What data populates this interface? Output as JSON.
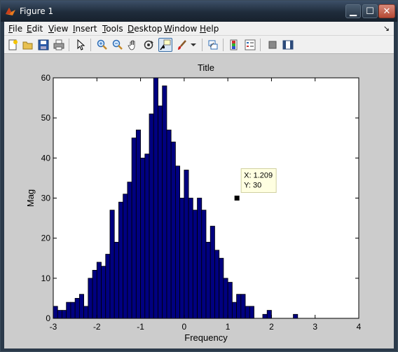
{
  "window": {
    "title": "Figure 1",
    "minimize": "▁",
    "maximize": "☐",
    "close": "✕"
  },
  "menu": [
    {
      "label": "File",
      "key": "F",
      "rest": "ile"
    },
    {
      "label": "Edit",
      "key": "E",
      "rest": "dit"
    },
    {
      "label": "View",
      "key": "V",
      "rest": "iew"
    },
    {
      "label": "Insert",
      "key": "I",
      "rest": "nsert"
    },
    {
      "label": "Tools",
      "key": "T",
      "rest": "ools"
    },
    {
      "label": "Desktop",
      "key": "D",
      "rest": "esktop"
    },
    {
      "label": "Window",
      "key": "W",
      "rest": "indow"
    },
    {
      "label": "Help",
      "key": "H",
      "rest": "elp"
    }
  ],
  "dock_arrow": "↘",
  "toolbar": [
    "new-figure-icon",
    "open-file-icon",
    "save-icon",
    "print-icon",
    "pointer-icon",
    "zoom-in-icon",
    "zoom-out-icon",
    "pan-hand-icon",
    "rotate-3d-icon",
    "data-cursor-icon",
    "brush-icon",
    "brush-dropdown-icon",
    "link-plot-icon",
    "colorbar-icon",
    "legend-icon",
    "hide-plot-tools-icon",
    "show-plot-tools-icon"
  ],
  "chart_data": {
    "type": "bar",
    "title": "Title",
    "xlabel": "Frequency",
    "ylabel": "Mag",
    "xlim": [
      -3,
      4
    ],
    "ylim": [
      0,
      60
    ],
    "xticks": [
      "-3",
      "-2",
      "-1",
      "0",
      "1",
      "2",
      "3",
      "4"
    ],
    "yticks": [
      "0",
      "10",
      "20",
      "30",
      "40",
      "50",
      "60"
    ],
    "bin_start": -2.95,
    "bin_width": 0.1,
    "values": [
      3,
      2,
      2,
      4,
      4,
      5,
      6,
      3,
      10,
      12,
      14,
      13,
      16,
      27,
      19,
      29,
      31,
      34,
      45,
      47,
      40,
      41,
      51,
      60,
      53,
      58,
      47,
      44,
      38,
      30,
      37,
      30,
      27,
      30,
      27,
      19,
      23,
      17,
      15,
      10,
      9,
      4,
      6,
      6,
      3,
      3,
      0,
      0,
      1,
      2,
      0,
      0,
      0,
      0,
      0,
      1,
      0,
      0,
      0,
      0,
      0,
      0,
      0,
      0,
      0,
      0,
      0,
      0,
      0,
      0
    ],
    "bar_color": "#000080",
    "datatip": {
      "x_text": "X: 1.209",
      "y_text": "Y: 30",
      "x": 1.209,
      "y": 30
    }
  }
}
